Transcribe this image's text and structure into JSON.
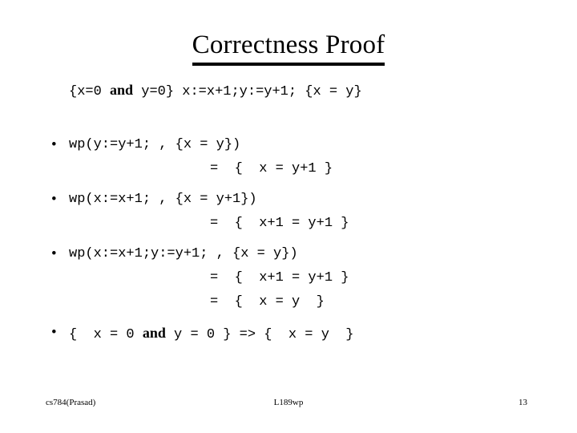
{
  "slide": {
    "title": "Correctness Proof",
    "hoare_triple": {
      "prefix": "{x=0 ",
      "keyword": "and",
      "suffix": " y=0} x:=x+1;y:=y+1; {x = y}"
    },
    "bullets": [
      {
        "marker": "•",
        "head": "wp(y:=y+1; , {x = y})",
        "continuations": [
          "=  {  x = y+1 }"
        ]
      },
      {
        "marker": "•",
        "head": "wp(x:=x+1; , {x = y+1})",
        "continuations": [
          "=  {  x+1 = y+1 }"
        ]
      },
      {
        "marker": "•",
        "head": "wp(x:=x+1;y:=y+1; , {x = y})",
        "continuations": [
          "=  {  x+1 = y+1 }",
          "=  {  x = y  }"
        ]
      },
      {
        "marker": "•",
        "head_prefix": "{  x = 0 ",
        "head_keyword": "and",
        "head_suffix": " y = 0 } => {  x = y  }",
        "continuations": []
      }
    ],
    "footer": {
      "left": "cs784(Prasad)",
      "center": "L189wp",
      "right": "13"
    }
  }
}
